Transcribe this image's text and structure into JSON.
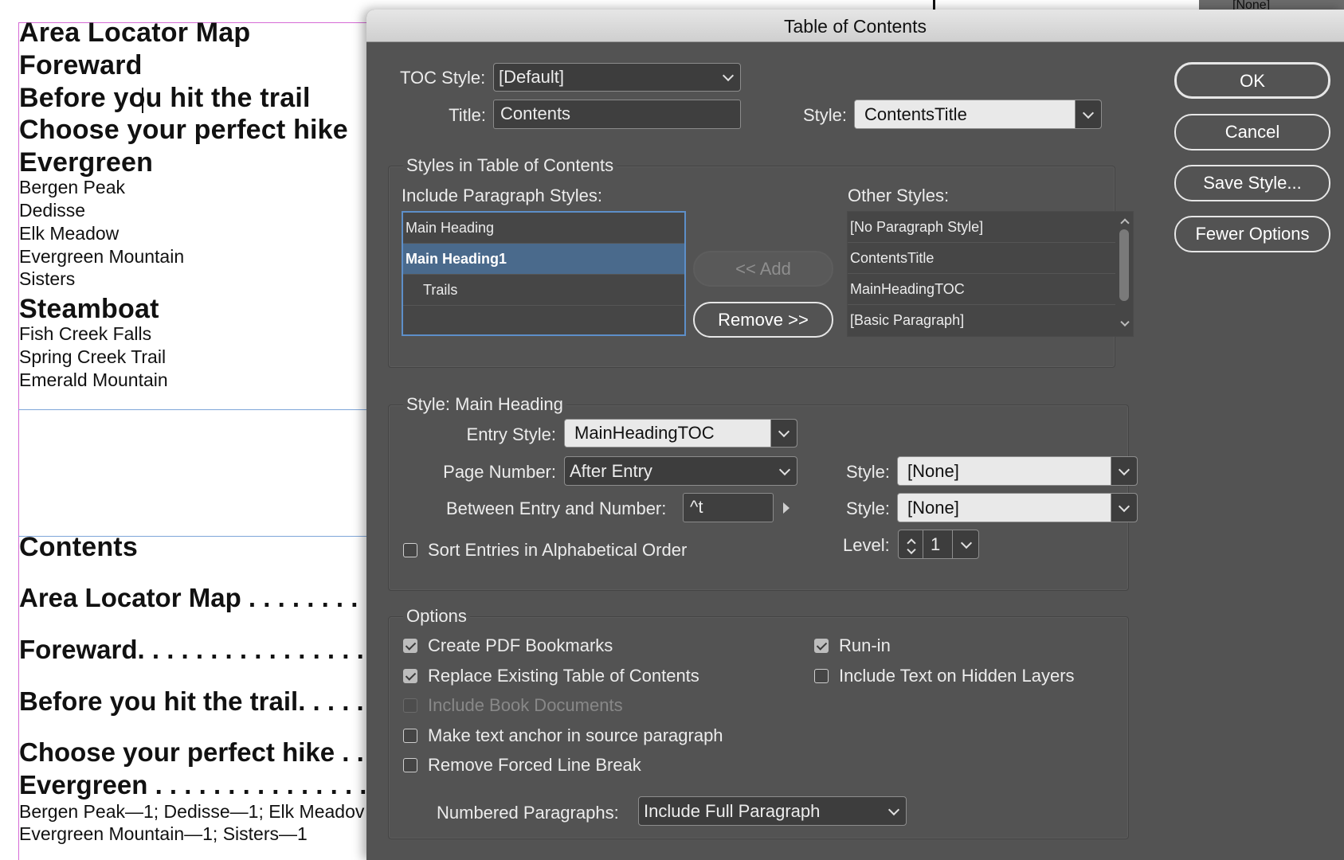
{
  "document": {
    "toc_lines": [
      {
        "text": "Area Locator Map",
        "type": "heading"
      },
      {
        "text": "Foreward",
        "type": "heading"
      },
      {
        "text": "Before you hit the trail",
        "type": "heading"
      },
      {
        "text": "Choose your perfect hike",
        "type": "heading"
      },
      {
        "text": "Evergreen",
        "type": "heading"
      },
      {
        "text": "Bergen Peak",
        "type": "sub"
      },
      {
        "text": "Dedisse",
        "type": "sub"
      },
      {
        "text": "Elk Meadow",
        "type": "sub"
      },
      {
        "text": "Evergreen Mountain",
        "type": "sub"
      },
      {
        "text": "Sisters",
        "type": "sub"
      },
      {
        "text": "Steamboat",
        "type": "heading"
      },
      {
        "text": "Fish Creek Falls",
        "type": "sub"
      },
      {
        "text": "Spring Creek Trail",
        "type": "sub"
      },
      {
        "text": "Emerald Mountain",
        "type": "sub"
      }
    ],
    "contents_title": "Contents",
    "generated": [
      "Area Locator Map . . . . . . . . .",
      "Foreward. . . . . . . . . . . . . . . . .",
      "Before you hit the trail. . . . .",
      "Choose your perfect hike . .",
      "Evergreen . . . . . . . . . . . . . . ."
    ],
    "run_in_line1": "Bergen Peak—1; Dedisse—1; Elk Meadov",
    "run_in_line2": "Evergreen Mountain—1; Sisters—1",
    "background_none": "[None]"
  },
  "dialog": {
    "title": "Table of Contents",
    "toc_style_label": "TOC Style:",
    "toc_style_value": "[Default]",
    "title_label": "Title:",
    "title_value": "Contents",
    "title_style_label": "Style:",
    "title_style_value": "ContentsTitle",
    "buttons": {
      "ok": "OK",
      "cancel": "Cancel",
      "save_style": "Save Style...",
      "fewer_options": "Fewer Options",
      "add": "<< Add",
      "remove": "Remove >>"
    },
    "styles_group": {
      "title": "Styles in Table of Contents",
      "include_label": "Include Paragraph Styles:",
      "include_items": [
        "Main Heading",
        "Main Heading1",
        "Trails",
        ""
      ],
      "other_label": "Other Styles:",
      "other_items": [
        "[No Paragraph Style]",
        "ContentsTitle",
        "MainHeadingTOC",
        "[Basic Paragraph]"
      ]
    },
    "style_group": {
      "title": "Style: Main Heading",
      "entry_style_label": "Entry Style:",
      "entry_style_value": "MainHeadingTOC",
      "page_number_label": "Page Number:",
      "page_number_value": "After Entry",
      "page_number_style_label": "Style:",
      "page_number_style_value": "[None]",
      "between_label": "Between Entry and Number:",
      "between_value": "^t",
      "between_style_label": "Style:",
      "between_style_value": "[None]",
      "sort_label": "Sort Entries in Alphabetical Order",
      "level_label": "Level:",
      "level_value": "1"
    },
    "options_group": {
      "title": "Options",
      "create_pdf_bookmarks": "Create PDF Bookmarks",
      "replace_existing": "Replace Existing Table of Contents",
      "include_book_documents": "Include Book Documents",
      "make_text_anchor": "Make text anchor in source paragraph",
      "remove_forced_line_break": "Remove Forced Line Break",
      "run_in": "Run-in",
      "include_hidden_layers": "Include Text on Hidden Layers",
      "numbered_paragraphs_label": "Numbered Paragraphs:",
      "numbered_paragraphs_value": "Include Full Paragraph"
    }
  }
}
